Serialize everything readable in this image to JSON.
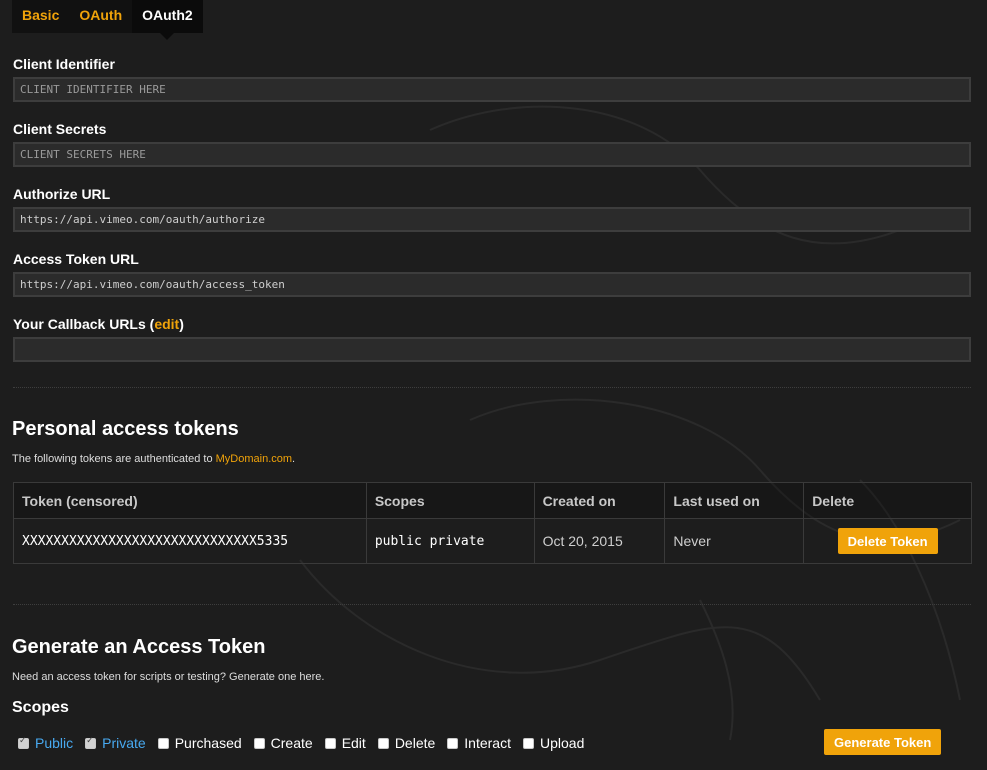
{
  "tabs": [
    {
      "label": "Basic",
      "active": false
    },
    {
      "label": "OAuth",
      "active": false
    },
    {
      "label": "OAuth2",
      "active": true
    }
  ],
  "fields": {
    "client_identifier": {
      "label": "Client Identifier",
      "value": "",
      "placeholder": "CLIENT IDENTIFIER HERE"
    },
    "client_secrets": {
      "label": "Client Secrets",
      "value": "",
      "placeholder": "CLIENT SECRETS HERE"
    },
    "authorize_url": {
      "label": "Authorize URL",
      "value": "https://api.vimeo.com/oauth/authorize",
      "placeholder": ""
    },
    "access_token_url": {
      "label": "Access Token URL",
      "value": "https://api.vimeo.com/oauth/access_token",
      "placeholder": ""
    },
    "callback_urls": {
      "label_prefix": "Your Callback URLs (",
      "edit_label": "edit",
      "label_suffix": ")",
      "value": "",
      "placeholder": ""
    }
  },
  "personal_tokens": {
    "title": "Personal access tokens",
    "desc_prefix": "The following tokens are authenticated to ",
    "domain": "MyDomain.com",
    "desc_suffix": ".",
    "columns": [
      "Token (censored)",
      "Scopes",
      "Created on",
      "Last used on",
      "Delete"
    ],
    "rows": [
      {
        "token": "XXXXXXXXXXXXXXXXXXXXXXXXXXXXXX5335",
        "scopes": "public private",
        "created": "Oct 20, 2015",
        "last_used": "Never",
        "delete_label": "Delete Token"
      }
    ]
  },
  "generate": {
    "title": "Generate an Access Token",
    "desc": "Need an access token for scripts or testing? Generate one here.",
    "scopes_label": "Scopes",
    "scopes": [
      {
        "label": "Public",
        "checked": true
      },
      {
        "label": "Private",
        "checked": true
      },
      {
        "label": "Purchased",
        "checked": false
      },
      {
        "label": "Create",
        "checked": false
      },
      {
        "label": "Edit",
        "checked": false
      },
      {
        "label": "Delete",
        "checked": false
      },
      {
        "label": "Interact",
        "checked": false
      },
      {
        "label": "Upload",
        "checked": false
      }
    ],
    "button_label": "Generate Token"
  },
  "colors": {
    "accent": "#f0a30a",
    "link_blue": "#48a9f0",
    "background": "#1d1d1d"
  }
}
